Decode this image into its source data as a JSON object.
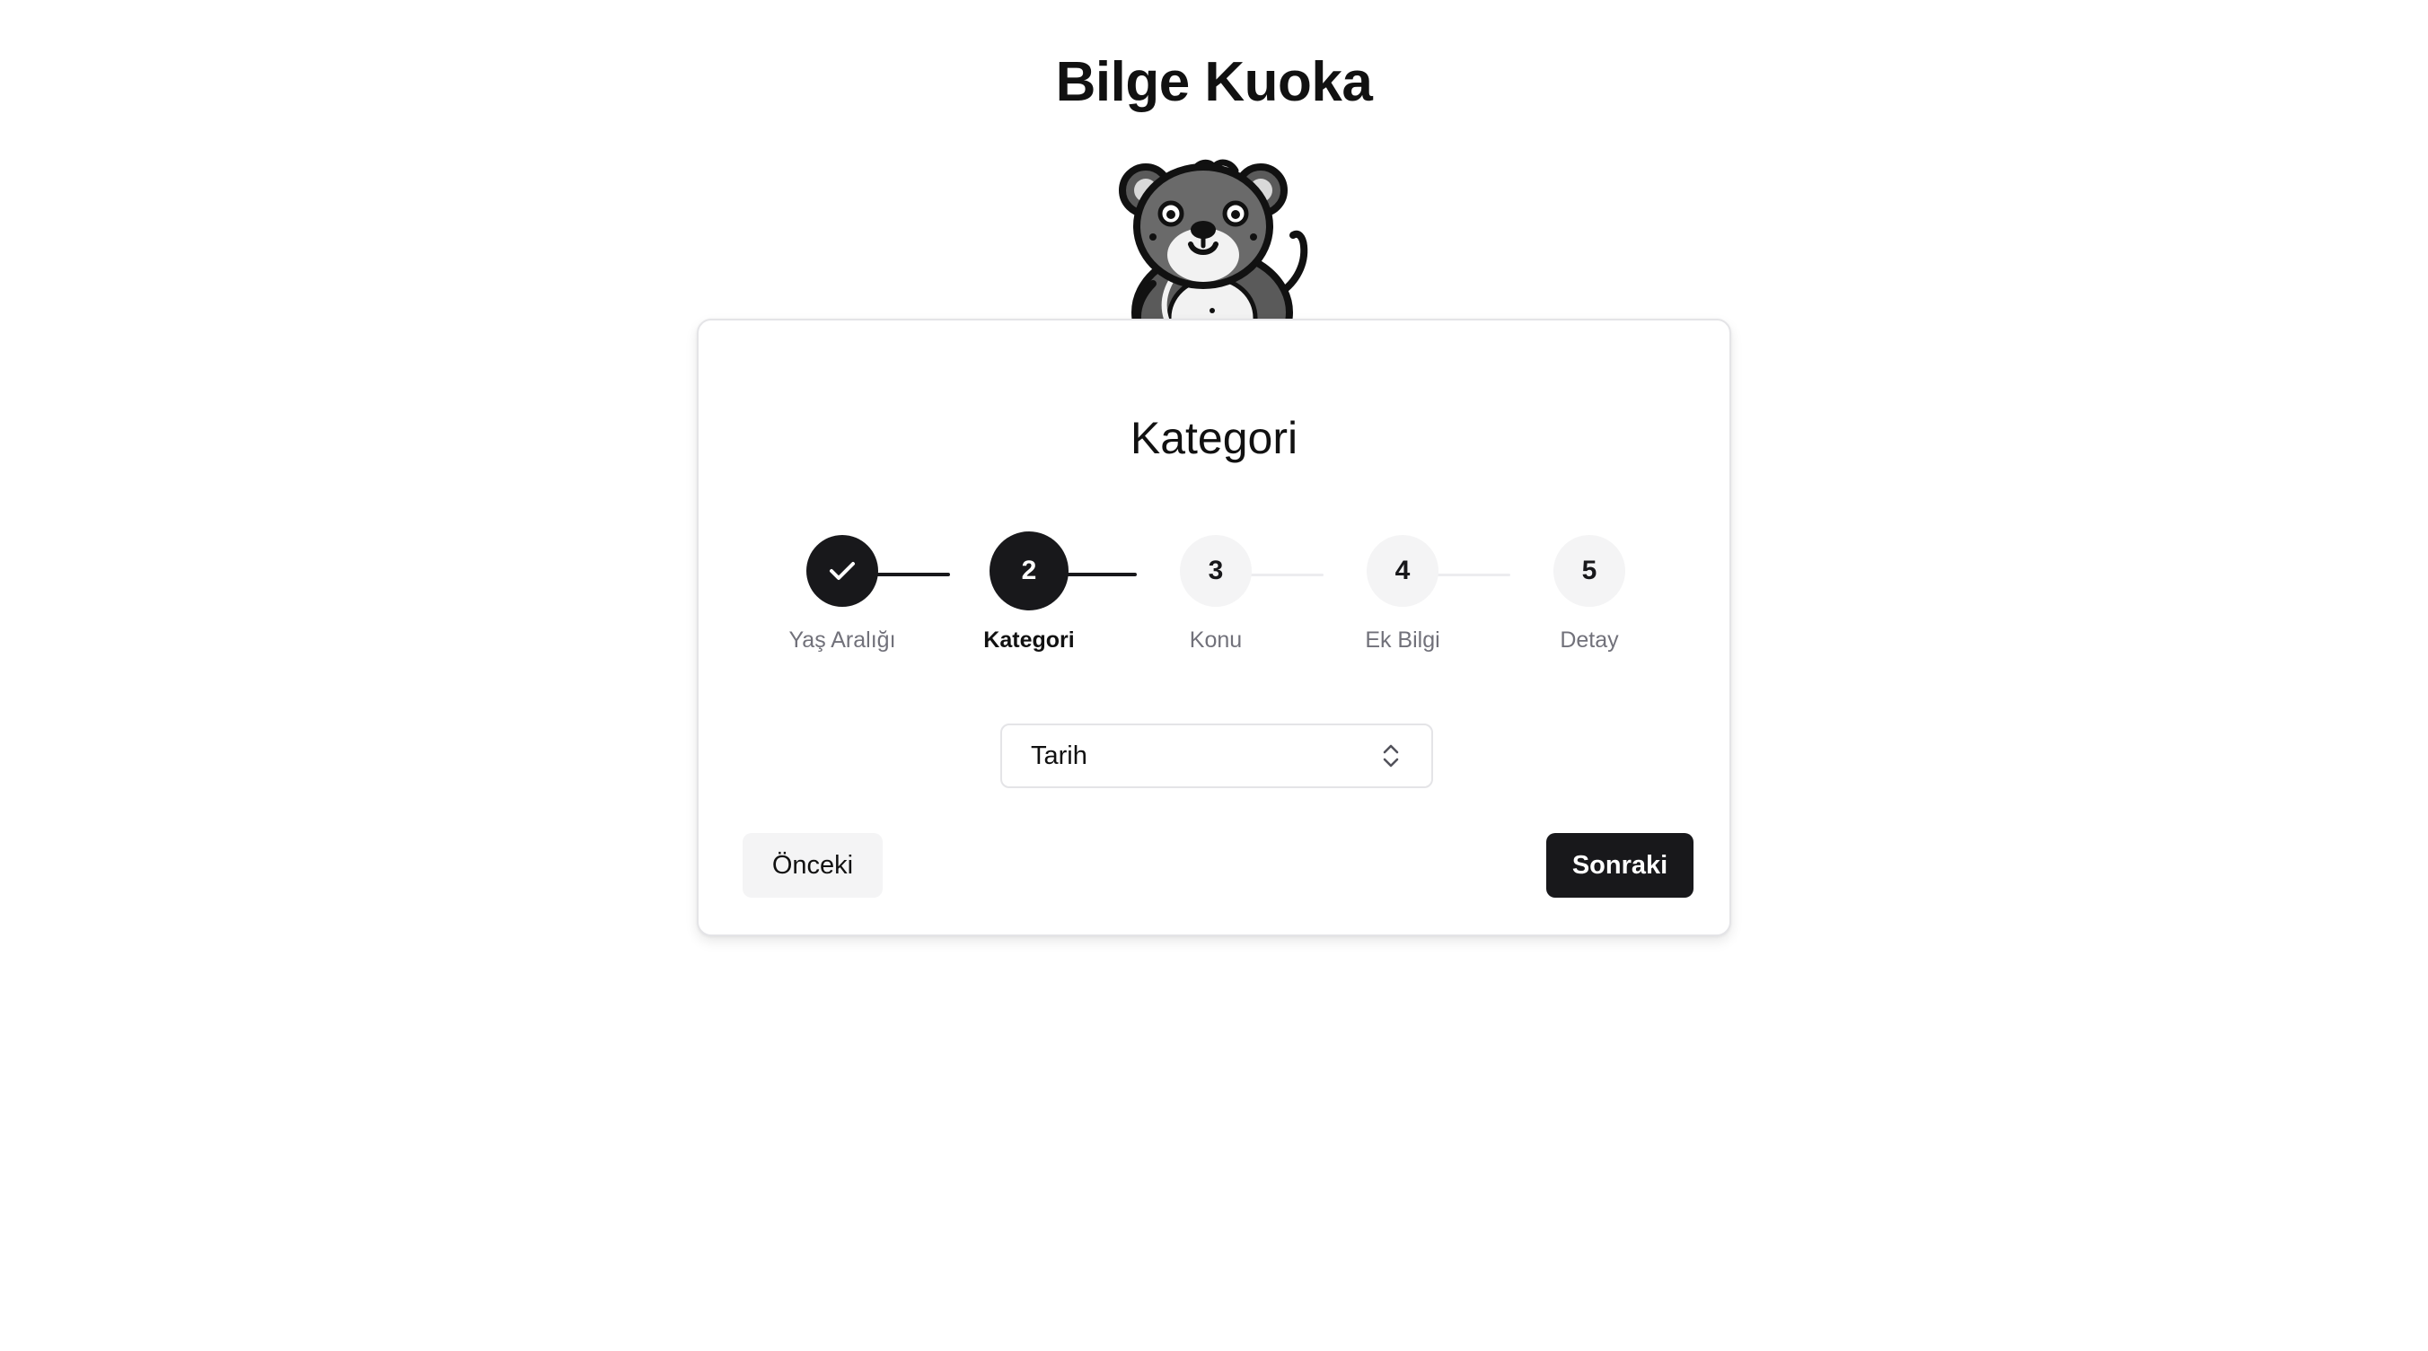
{
  "app": {
    "title": "Bilge Kuoka",
    "mascot_icon": "koala-mascot-icon"
  },
  "wizard": {
    "heading": "Kategori",
    "current_step": 2,
    "steps": [
      {
        "number": "1",
        "label": "Yaş Aralığı",
        "status": "completed",
        "icon": "check-icon"
      },
      {
        "number": "2",
        "label": "Kategori",
        "status": "active"
      },
      {
        "number": "3",
        "label": "Konu",
        "status": "upcoming"
      },
      {
        "number": "4",
        "label": "Ek Bilgi",
        "status": "upcoming"
      },
      {
        "number": "5",
        "label": "Detay",
        "status": "upcoming"
      }
    ],
    "category_select": {
      "value": "Tarih",
      "icon": "chevron-up-down-icon"
    },
    "buttons": {
      "previous": "Önceki",
      "next": "Sonraki"
    }
  },
  "colors": {
    "primary": "#18181b",
    "muted_bg": "#f4f4f5",
    "border": "#e4e4e7",
    "muted_text": "#71717a"
  }
}
